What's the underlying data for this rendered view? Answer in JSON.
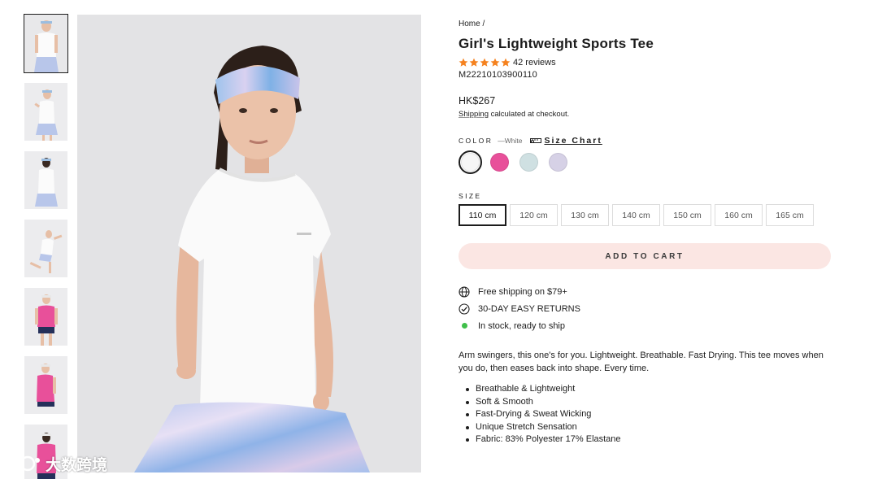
{
  "gallery": {
    "thumbnails": [
      {
        "alt": "thumbnail-1",
        "active": true
      },
      {
        "alt": "thumbnail-2",
        "active": false
      },
      {
        "alt": "thumbnail-3",
        "active": false
      },
      {
        "alt": "thumbnail-4",
        "active": false
      },
      {
        "alt": "thumbnail-5",
        "active": false
      },
      {
        "alt": "thumbnail-6",
        "active": false
      },
      {
        "alt": "thumbnail-7",
        "active": false
      }
    ]
  },
  "watermark": {
    "text": "大数跨境"
  },
  "product": {
    "breadcrumb": {
      "home": "Home",
      "separator": "/"
    },
    "title": "Girl's Lightweight Sports Tee",
    "rating": {
      "stars": 5,
      "reviews_label": "42 reviews",
      "star_color": "#f5821f"
    },
    "sku": "M22210103900110",
    "price": "HK$267",
    "shipping_link": "Shipping",
    "shipping_rest": " calculated at checkout.",
    "color": {
      "label": "COLOR",
      "selected_prefix": "—",
      "selected": "White",
      "size_chart_label": "Size Chart",
      "swatches": [
        {
          "name": "White",
          "color": "#f6f6f6",
          "active": true
        },
        {
          "name": "Pink",
          "color": "#e8509a",
          "active": false
        },
        {
          "name": "Light Blue",
          "color": "#cfe0e2",
          "active": false
        },
        {
          "name": "Lavender",
          "color": "#d6d1e6",
          "active": false
        }
      ]
    },
    "size": {
      "label": "SIZE",
      "options": [
        {
          "label": "110 cm",
          "active": true
        },
        {
          "label": "120 cm",
          "active": false
        },
        {
          "label": "130 cm",
          "active": false
        },
        {
          "label": "140 cm",
          "active": false
        },
        {
          "label": "150 cm",
          "active": false
        },
        {
          "label": "160 cm",
          "active": false
        },
        {
          "label": "165 cm",
          "active": false
        }
      ]
    },
    "add_to_cart": "ADD TO CART",
    "features": {
      "shipping": "Free shipping on $79+",
      "returns": "30-DAY EASY RETURNS",
      "stock": "In stock, ready to ship"
    },
    "description": "Arm swingers, this one's for you. Lightweight. Breathable. Fast Drying. This tee moves when you do, then eases back into shape. Every time.",
    "bullets": [
      "Breathable & Lightweight",
      "Soft & Smooth",
      "Fast-Drying & Sweat Wicking",
      "Unique Stretch Sensation",
      "Fabric: 83% Polyester 17% Elastane"
    ]
  }
}
